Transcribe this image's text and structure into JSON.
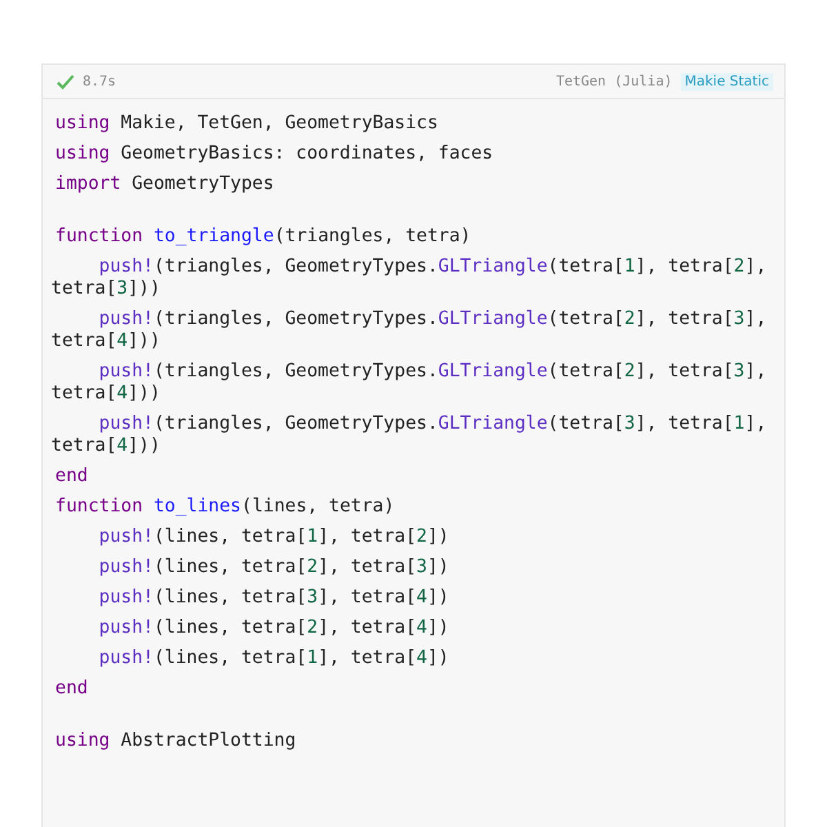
{
  "cell": {
    "duration": "8.7s",
    "title": "TetGen (Julia)",
    "tag": "Makie Static"
  },
  "blocks": [
    [
      {
        "tokens": [
          {
            "kind": "kw",
            "text": "using"
          },
          {
            "kind": "plain",
            "text": " Makie, TetGen, GeometryBasics"
          }
        ]
      },
      {
        "tokens": [
          {
            "kind": "kw",
            "text": "using"
          },
          {
            "kind": "plain",
            "text": " GeometryBasics: coordinates, faces"
          }
        ]
      },
      {
        "tokens": [
          {
            "kind": "kw",
            "text": "import"
          },
          {
            "kind": "plain",
            "text": " GeometryTypes"
          }
        ]
      }
    ],
    [
      {
        "tokens": [
          {
            "kind": "kw",
            "text": "function"
          },
          {
            "kind": "def",
            "text": " to_triangle"
          },
          {
            "kind": "plain",
            "text": "(triangles, tetra)"
          }
        ],
        "children": [
          {
            "tokens": [
              {
                "kind": "call",
                "text": "push!"
              },
              {
                "kind": "plain",
                "text": "(triangles, GeometryTypes."
              },
              {
                "kind": "call",
                "text": "GLTriangle"
              },
              {
                "kind": "plain",
                "text": "(tetra["
              },
              {
                "kind": "num",
                "text": "1"
              },
              {
                "kind": "plain",
                "text": "], tetra["
              },
              {
                "kind": "num",
                "text": "2"
              },
              {
                "kind": "plain",
                "text": "], tetra["
              },
              {
                "kind": "num",
                "text": "3"
              },
              {
                "kind": "plain",
                "text": "]))"
              }
            ]
          },
          {
            "tokens": [
              {
                "kind": "call",
                "text": "push!"
              },
              {
                "kind": "plain",
                "text": "(triangles, GeometryTypes."
              },
              {
                "kind": "call",
                "text": "GLTriangle"
              },
              {
                "kind": "plain",
                "text": "(tetra["
              },
              {
                "kind": "num",
                "text": "2"
              },
              {
                "kind": "plain",
                "text": "], tetra["
              },
              {
                "kind": "num",
                "text": "3"
              },
              {
                "kind": "plain",
                "text": "], tetra["
              },
              {
                "kind": "num",
                "text": "4"
              },
              {
                "kind": "plain",
                "text": "]))"
              }
            ]
          },
          {
            "tokens": [
              {
                "kind": "call",
                "text": "push!"
              },
              {
                "kind": "plain",
                "text": "(triangles, GeometryTypes."
              },
              {
                "kind": "call",
                "text": "GLTriangle"
              },
              {
                "kind": "plain",
                "text": "(tetra["
              },
              {
                "kind": "num",
                "text": "2"
              },
              {
                "kind": "plain",
                "text": "], tetra["
              },
              {
                "kind": "num",
                "text": "3"
              },
              {
                "kind": "plain",
                "text": "], tetra["
              },
              {
                "kind": "num",
                "text": "4"
              },
              {
                "kind": "plain",
                "text": "]))"
              }
            ]
          },
          {
            "tokens": [
              {
                "kind": "call",
                "text": "push!"
              },
              {
                "kind": "plain",
                "text": "(triangles, GeometryTypes."
              },
              {
                "kind": "call",
                "text": "GLTriangle"
              },
              {
                "kind": "plain",
                "text": "(tetra["
              },
              {
                "kind": "num",
                "text": "3"
              },
              {
                "kind": "plain",
                "text": "], tetra["
              },
              {
                "kind": "num",
                "text": "1"
              },
              {
                "kind": "plain",
                "text": "], tetra["
              },
              {
                "kind": "num",
                "text": "4"
              },
              {
                "kind": "plain",
                "text": "]))"
              }
            ]
          }
        ]
      },
      {
        "tokens": [
          {
            "kind": "kw",
            "text": "end"
          }
        ]
      },
      {
        "tokens": [
          {
            "kind": "kw",
            "text": "function"
          },
          {
            "kind": "def",
            "text": " to_lines"
          },
          {
            "kind": "plain",
            "text": "(lines, tetra)"
          }
        ],
        "children": [
          {
            "tokens": [
              {
                "kind": "call",
                "text": "push!"
              },
              {
                "kind": "plain",
                "text": "(lines, tetra["
              },
              {
                "kind": "num",
                "text": "1"
              },
              {
                "kind": "plain",
                "text": "], tetra["
              },
              {
                "kind": "num",
                "text": "2"
              },
              {
                "kind": "plain",
                "text": "])"
              }
            ]
          },
          {
            "tokens": [
              {
                "kind": "call",
                "text": "push!"
              },
              {
                "kind": "plain",
                "text": "(lines, tetra["
              },
              {
                "kind": "num",
                "text": "2"
              },
              {
                "kind": "plain",
                "text": "], tetra["
              },
              {
                "kind": "num",
                "text": "3"
              },
              {
                "kind": "plain",
                "text": "])"
              }
            ]
          },
          {
            "tokens": [
              {
                "kind": "call",
                "text": "push!"
              },
              {
                "kind": "plain",
                "text": "(lines, tetra["
              },
              {
                "kind": "num",
                "text": "3"
              },
              {
                "kind": "plain",
                "text": "], tetra["
              },
              {
                "kind": "num",
                "text": "4"
              },
              {
                "kind": "plain",
                "text": "])"
              }
            ]
          },
          {
            "tokens": [
              {
                "kind": "call",
                "text": "push!"
              },
              {
                "kind": "plain",
                "text": "(lines, tetra["
              },
              {
                "kind": "num",
                "text": "2"
              },
              {
                "kind": "plain",
                "text": "], tetra["
              },
              {
                "kind": "num",
                "text": "4"
              },
              {
                "kind": "plain",
                "text": "])"
              }
            ]
          },
          {
            "tokens": [
              {
                "kind": "call",
                "text": "push!"
              },
              {
                "kind": "plain",
                "text": "(lines, tetra["
              },
              {
                "kind": "num",
                "text": "1"
              },
              {
                "kind": "plain",
                "text": "], tetra["
              },
              {
                "kind": "num",
                "text": "4"
              },
              {
                "kind": "plain",
                "text": "])"
              }
            ]
          }
        ]
      },
      {
        "tokens": [
          {
            "kind": "kw",
            "text": "end"
          }
        ]
      }
    ],
    [
      {
        "tokens": [
          {
            "kind": "kw",
            "text": "using"
          },
          {
            "kind": "plain",
            "text": " AbstractPlotting"
          }
        ]
      }
    ]
  ]
}
